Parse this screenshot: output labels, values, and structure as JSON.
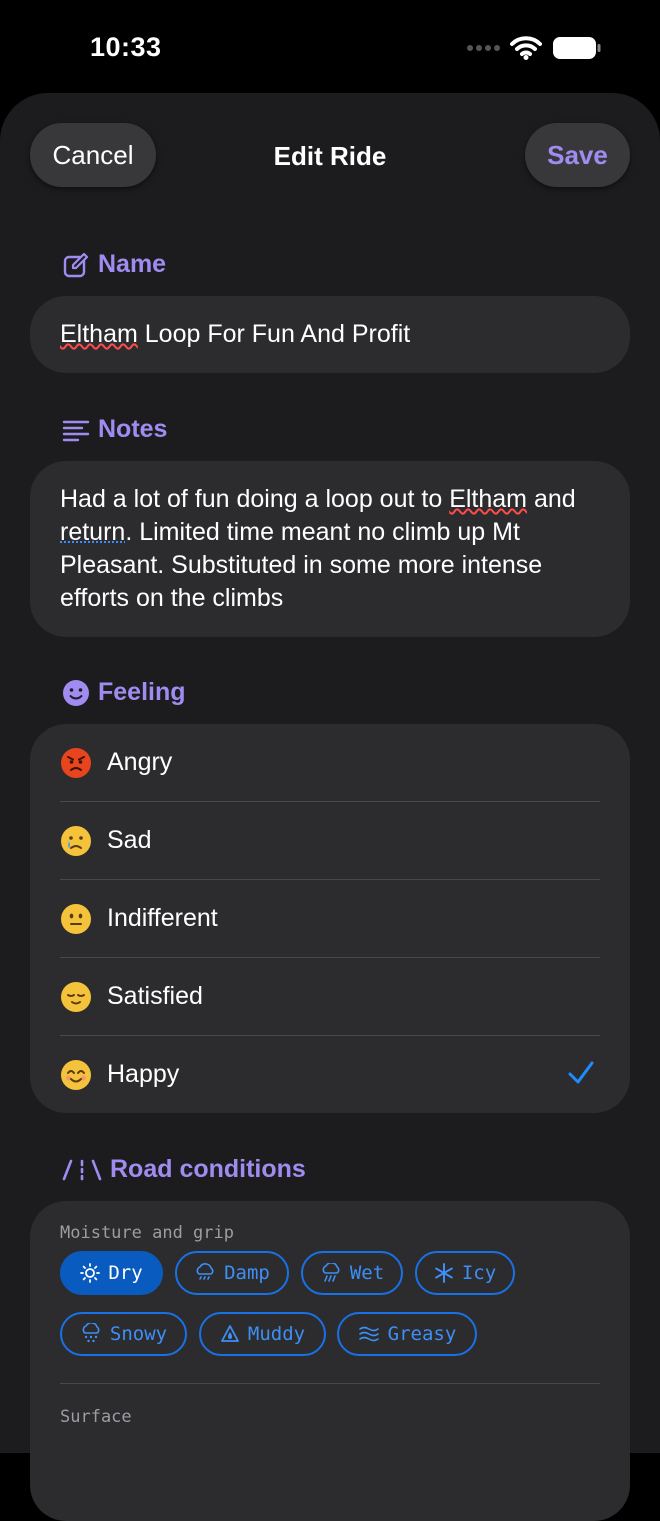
{
  "status": {
    "time": "10:33"
  },
  "header": {
    "cancel_label": "Cancel",
    "title": "Edit Ride",
    "save_label": "Save"
  },
  "name_section": {
    "title": "Name",
    "icon": "pencil-square-icon",
    "word1": "Eltham",
    "rest": " Loop For Fun And Profit"
  },
  "notes_section": {
    "title": "Notes",
    "icon": "text-lines-icon",
    "p1": "Had a lot of fun doing a loop out to ",
    "w1": "Eltham",
    "p2": " and ",
    "w2": "return",
    "p3": ". Limited time meant no climb up Mt Pleasant. Substituted in some more intense efforts on the climbs"
  },
  "feeling_section": {
    "title": "Feeling",
    "icon": "smiley-icon",
    "options": [
      {
        "label": "Angry",
        "emoji": "angry-face-icon",
        "selected": false
      },
      {
        "label": "Sad",
        "emoji": "crying-face-icon",
        "selected": false
      },
      {
        "label": "Indifferent",
        "emoji": "neutral-face-icon",
        "selected": false
      },
      {
        "label": "Satisfied",
        "emoji": "relieved-face-icon",
        "selected": false
      },
      {
        "label": "Happy",
        "emoji": "smiling-face-icon",
        "selected": true
      }
    ]
  },
  "road_section": {
    "title": "Road conditions",
    "icon": "road-icon",
    "moisture_label": "Moisture and grip",
    "chips": [
      {
        "label": "Dry",
        "icon": "sun-icon",
        "selected": true
      },
      {
        "label": "Damp",
        "icon": "drizzle-icon",
        "selected": false
      },
      {
        "label": "Wet",
        "icon": "rain-icon",
        "selected": false
      },
      {
        "label": "Icy",
        "icon": "snowflake-icon",
        "selected": false
      },
      {
        "label": "Snowy",
        "icon": "snow-cloud-icon",
        "selected": false
      },
      {
        "label": "Muddy",
        "icon": "drop-triangle-icon",
        "selected": false
      },
      {
        "label": "Greasy",
        "icon": "waves-icon",
        "selected": false
      }
    ],
    "surface_label": "Surface"
  },
  "colors": {
    "accent": "#a08cf0",
    "blue": "#1971e6",
    "selected_chip": "#0a5bbf",
    "card": "#2c2c2e",
    "sheet": "#1c1c1e"
  }
}
